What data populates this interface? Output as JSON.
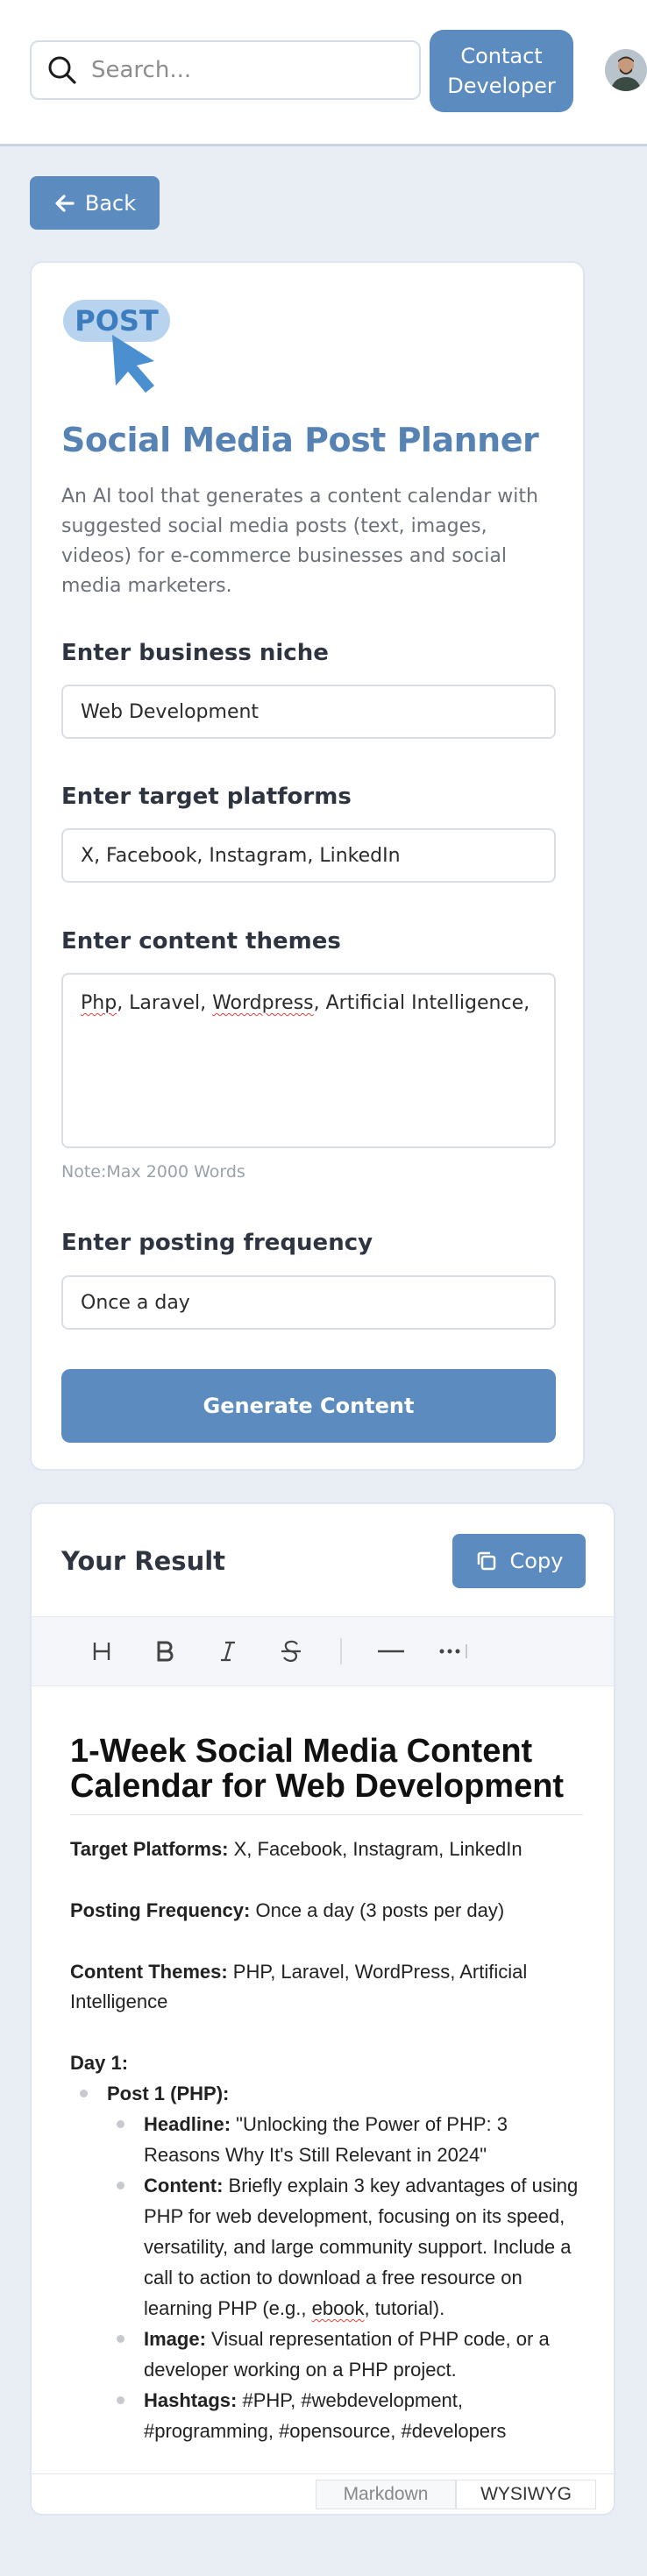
{
  "header": {
    "search_placeholder": "Search...",
    "contact_label": "Contact\nDeveloper"
  },
  "back_label": "Back",
  "tool": {
    "logo_text": "POST",
    "title": "Social Media Post Planner",
    "description": "An AI tool that generates a content calendar with suggested social media posts (text, images, videos) for e-commerce businesses and social media marketers.",
    "niche_label": "Enter business niche",
    "niche_value": "Web Development",
    "platforms_label": "Enter target platforms",
    "platforms_value": "X, Facebook, Instagram, LinkedIn",
    "themes_label": "Enter content themes",
    "themes_parts": [
      "Php",
      ", Laravel, ",
      "Wordpress",
      ", Artificial Intelligence,"
    ],
    "themes_note": "Note:Max 2000 Words",
    "frequency_label": "Enter posting frequency",
    "frequency_value": "Once a day",
    "generate_label": "Generate Content"
  },
  "result": {
    "title": "Your Result",
    "copy_label": "Copy",
    "toolbar": [
      "heading-icon",
      "bold-icon",
      "italic-icon",
      "strikethrough-icon",
      "horizontal-rule-icon",
      "more-icon"
    ],
    "heading": "1-Week Social Media Content Calendar for Web Development",
    "platforms_k": "Target Platforms:",
    "platforms_v": " X, Facebook, Instagram, LinkedIn",
    "frequency_k": "Posting Frequency:",
    "frequency_v": " Once a day (3 posts per day)",
    "themes_k": "Content Themes:",
    "themes_v": " PHP, Laravel, WordPress, Artificial Intelligence",
    "day1": "Day 1:",
    "post1": "Post 1 (PHP):",
    "headline_k": "Headline:",
    "headline_v": " \"Unlocking the Power of PHP: 3 Reasons Why It's Still Relevant in 2024\"",
    "content_k": "Content:",
    "content_v1": " Briefly explain 3 key advantages of using PHP for web development, focusing on its speed, versatility, and large community support. Include a call to action to download a free resource on learning PHP (e.g., ",
    "content_ebook": "ebook",
    "content_v2": ", tutorial).",
    "image_k": "Image:",
    "image_v": " Visual representation of PHP code, or a developer working on a PHP project.",
    "hashtags_k": "Hashtags:",
    "hashtags_v": " #PHP, #webdevelopment, #programming, #opensource, #developers",
    "mode_markdown": "Markdown",
    "mode_wysiwyg": "WYSIWYG"
  },
  "colors": {
    "accent": "#5b8bbf",
    "title": "#5683b3",
    "background": "#e9eef5"
  }
}
